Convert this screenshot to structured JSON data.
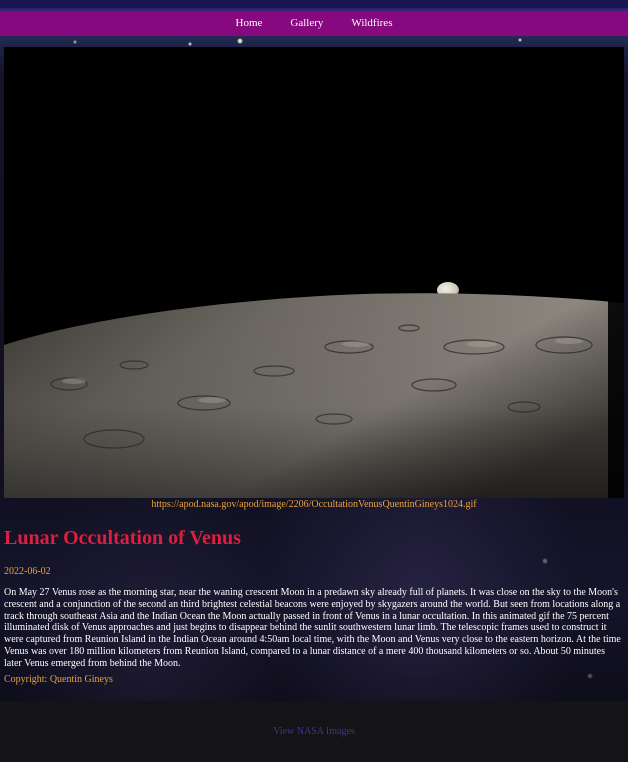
{
  "nav": {
    "links": [
      "Home",
      "Gallery",
      "Wildfires"
    ]
  },
  "apod": {
    "image_url": "https://apod.nasa.gov/apod/image/2206/OccultationVenusQuentinGineys1024.gif",
    "title": "Lunar Occultation of Venus",
    "date": "2022-06-02",
    "explanation": "On May 27 Venus rose as the morning star, near the waning crescent Moon in a predawn sky already full of planets. It was close on the sky to the Moon's crescent and a conjunction of the second an third brightest celestial beacons were enjoyed by skygazers around the world. But seen from locations along a track through southeast Asia and the Indian Ocean the Moon actually passed in front of Venus in a lunar occultation. In this animated gif the 75 percent illuminated disk of Venus approaches and just begins to disappear behind the sunlit southwestern lunar limb. The telescopic frames used to construct it were captured from Reunion Island in the Indian Ocean around 4:50am local time, with the Moon and Venus very close to the eastern horizon. At the time Venus was over 180 million kilometers from Reunion Island, compared to a lunar distance of a mere 400 thousand kilometers or so. About 50 minutes later Venus emerged from behind the Moon.",
    "copyright": "Copyright: Quentin Gineys"
  },
  "footer": {
    "link_label": "View NASA Images"
  },
  "colors": {
    "nav_bg": "#86097f",
    "title": "#dc1f3f",
    "accent_text": "#e9a33c",
    "footer_link": "#4b2f8a"
  }
}
